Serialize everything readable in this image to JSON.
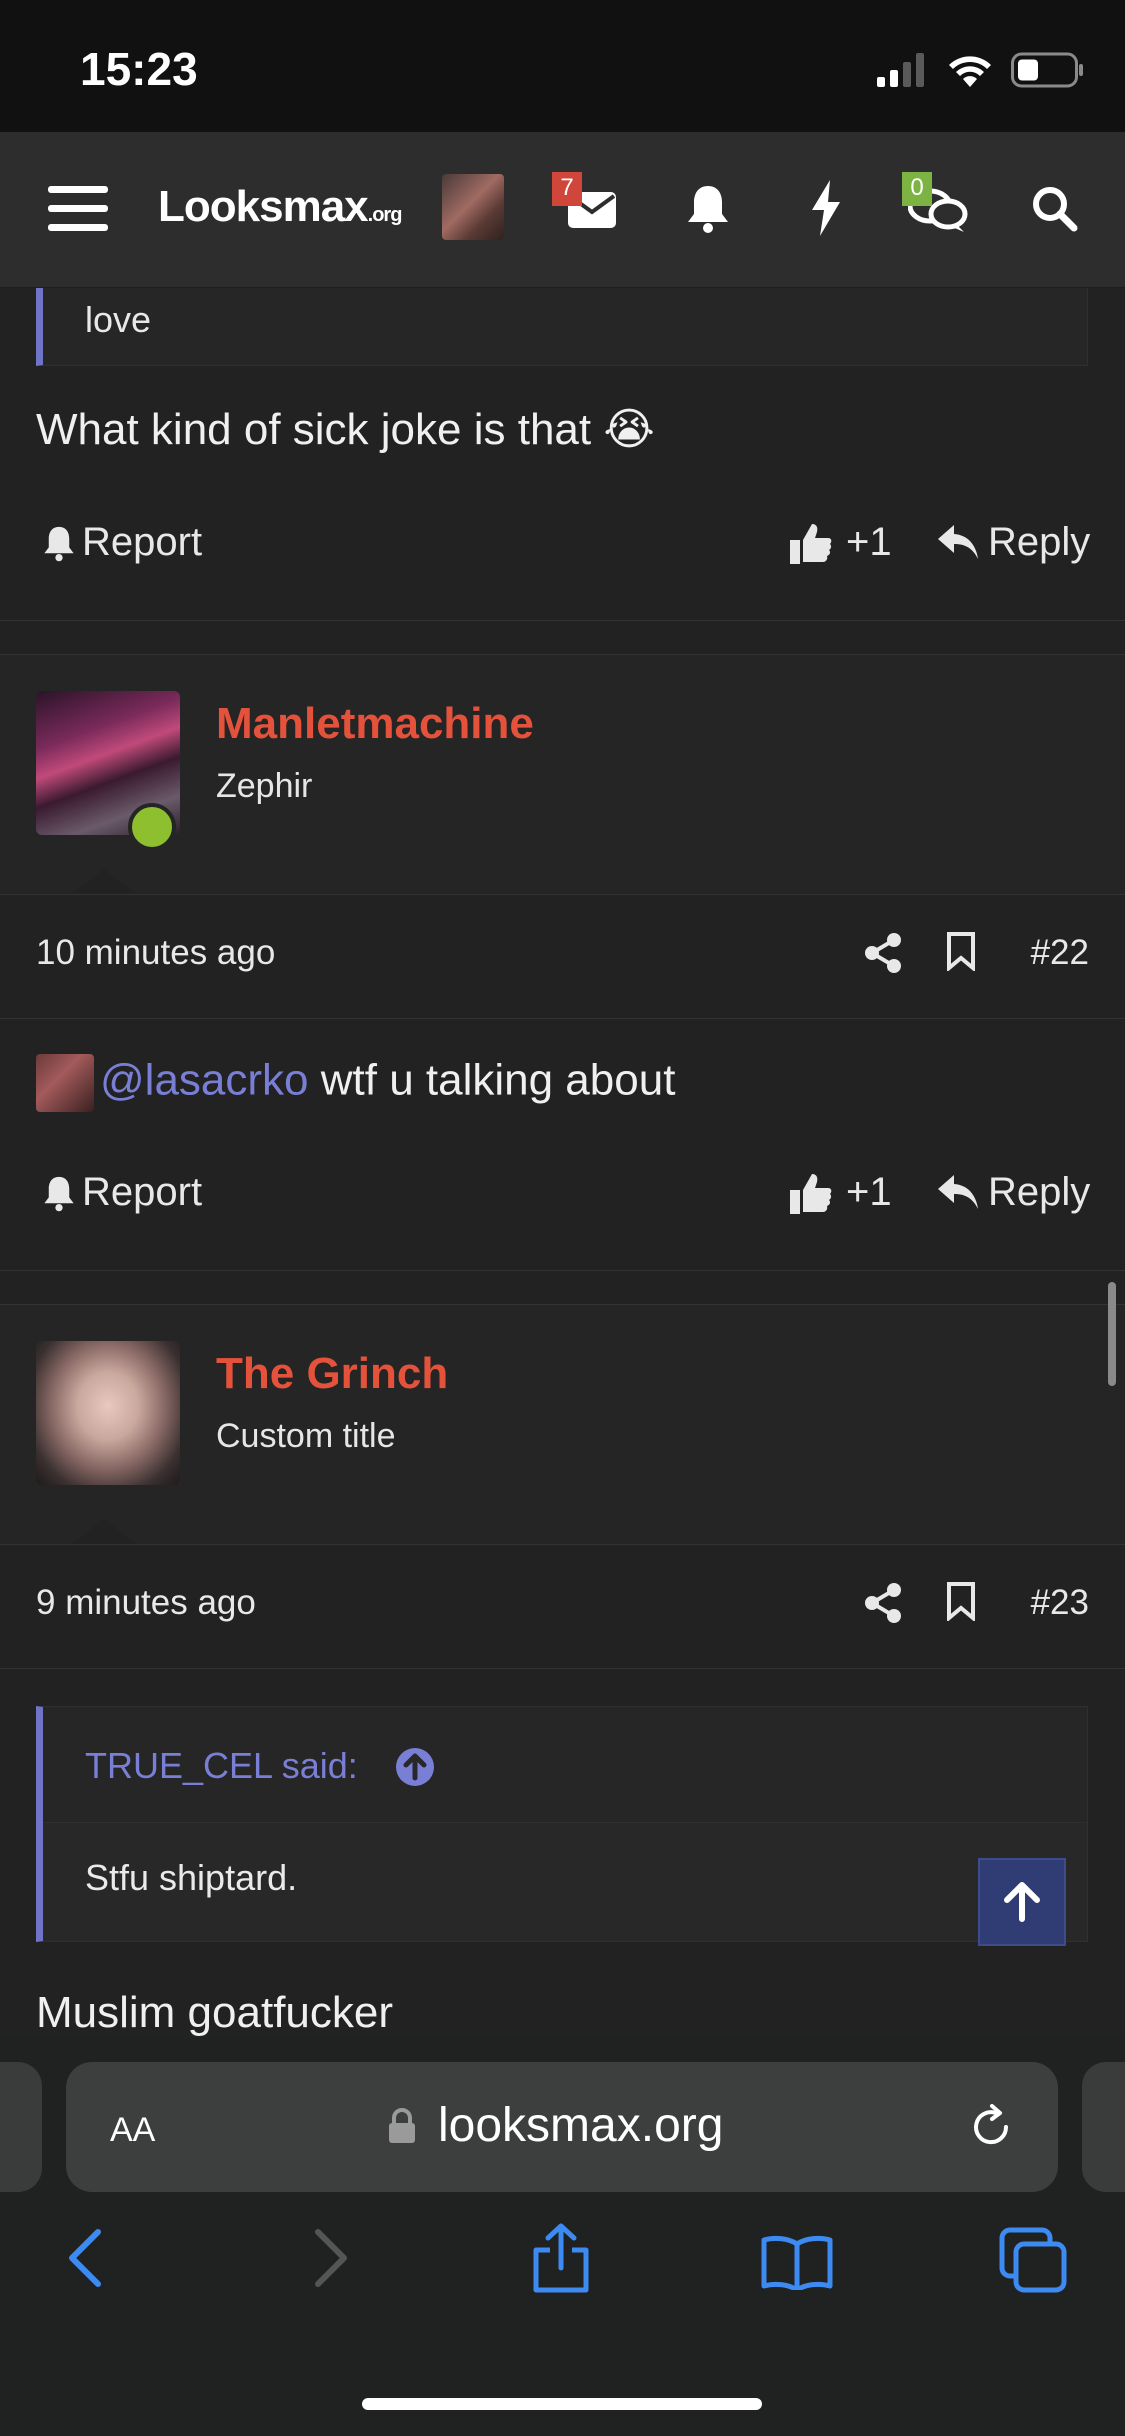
{
  "status": {
    "time": "15:23"
  },
  "navbar": {
    "logo_main": "Looksmax",
    "logo_suffix": ".org",
    "inbox_count": "7",
    "chat_count": "0"
  },
  "post21_tail": {
    "quote_text": "love",
    "message": "What kind of sick joke is that 😭",
    "report_label": "Report",
    "like_count": "+1",
    "reply_label": "Reply"
  },
  "post22": {
    "username": "Manletmachine",
    "user_title": "Zephir",
    "time_ago": "10 minutes ago",
    "post_number": "#22",
    "mention": "@lasacrko",
    "message": "wtf u talking about",
    "report_label": "Report",
    "like_count": "+1",
    "reply_label": "Reply"
  },
  "post23": {
    "username": "The Grinch",
    "user_title": "Custom title",
    "time_ago": "9 minutes ago",
    "post_number": "#23",
    "quote_author": "TRUE_CEL said:",
    "quote_text": "Stfu shiptard.",
    "message": "Muslim goatfucker"
  },
  "browser": {
    "aa_label": "AA",
    "host": "looksmax.org"
  },
  "colors": {
    "accent": "#7a7fd6",
    "username": "#e4523b",
    "online": "#8dbf2e",
    "inbox_badge": "#d0463a",
    "chat_badge": "#7cb342",
    "browser_blue": "#3d8bf2"
  }
}
